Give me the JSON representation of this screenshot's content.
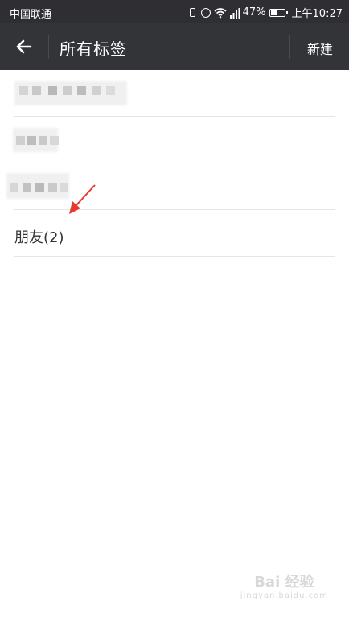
{
  "status_bar": {
    "carrier": "中国联通",
    "signal_type": "4G",
    "battery_percent": "47%",
    "battery_level": 0.47,
    "time": "上午10:27"
  },
  "app_bar": {
    "title": "所有标签",
    "new_label": "新建",
    "back_icon": "arrow-left-icon"
  },
  "tags": {
    "items": [
      {
        "label": "",
        "blurred": true
      },
      {
        "label": "",
        "blurred": true
      },
      {
        "label": "",
        "blurred": true
      },
      {
        "label": "朋友(2)",
        "blurred": false
      }
    ]
  },
  "annotation": {
    "arrow_color": "#e8392f"
  },
  "watermark": {
    "text": "Bai 经验",
    "url_text": "jingyan.baidu.com"
  },
  "colors": {
    "header_bg": "#333438",
    "status_bg": "#2f2f33",
    "list_bg": "#ffffff",
    "divider": "#e5e5e5"
  }
}
